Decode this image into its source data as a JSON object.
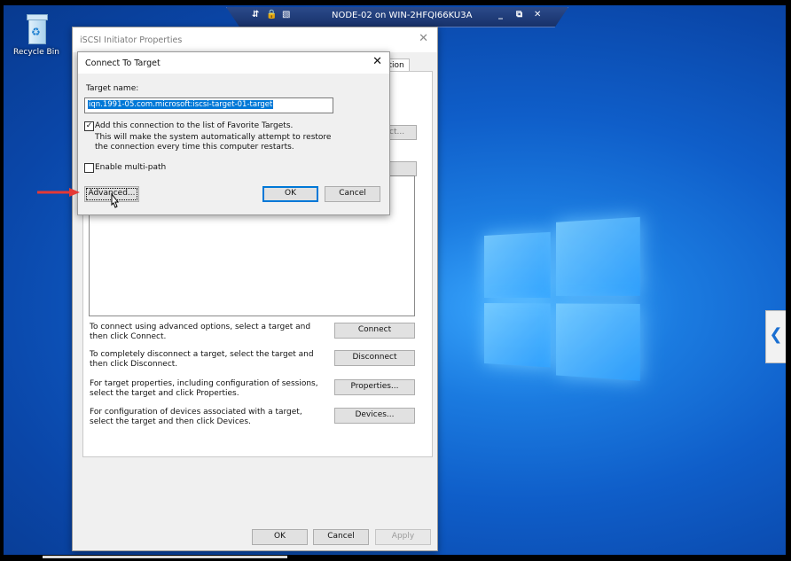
{
  "rdp_bar": {
    "title": "NODE-02 on WIN-2HFQI66KU3A",
    "min": "_",
    "restore": "⧉",
    "close": "✕"
  },
  "desktop": {
    "recycle_bin_label": "Recycle Bin"
  },
  "iscsi_window": {
    "title": "iSCSI Initiator Properties",
    "tab_fragment": "ation",
    "partial_button": "ct...",
    "hint_connect": "To connect using advanced options, select a target and then click Connect.",
    "hint_disconnect": "To completely disconnect a target, select the target and then click Disconnect.",
    "hint_properties": "For target properties, including configuration of sessions, select the target and click Properties.",
    "hint_devices": "For configuration of devices associated with a target, select the target and then click Devices.",
    "connect_btn": "Connect",
    "disconnect_btn": "Disconnect",
    "properties_btn": "Properties...",
    "devices_btn": "Devices...",
    "ok_btn": "OK",
    "cancel_btn": "Cancel",
    "apply_btn": "Apply"
  },
  "connect_dialog": {
    "title": "Connect To Target",
    "target_name_label": "Target name:",
    "target_name_value": "iqn.1991-05.com.microsoft:iscsi-target-01-target",
    "favorite_checked": true,
    "favorite_label": "Add this connection to the list of Favorite Targets.",
    "favorite_desc": "This will make the system automatically attempt to restore the connection every time this computer restarts.",
    "multipath_checked": false,
    "multipath_label": "Enable multi-path",
    "advanced_btn": "Advanced...",
    "ok_btn": "OK",
    "cancel_btn": "Cancel"
  },
  "colors": {
    "selection": "#0078d7",
    "arrow": "#e53935"
  }
}
